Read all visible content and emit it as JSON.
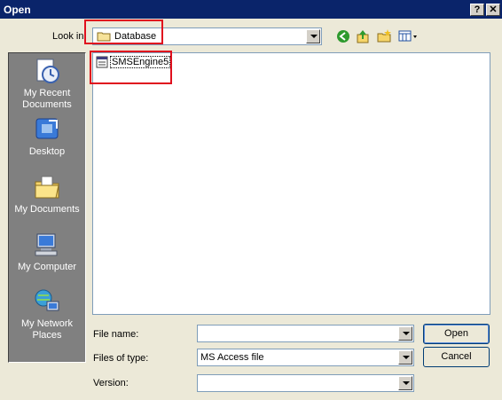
{
  "window": {
    "title": "Open",
    "help_label": "?",
    "close_label": "✕"
  },
  "lookin": {
    "label": "Look in",
    "value": "Database"
  },
  "toolbar": {
    "back_icon": "back-icon",
    "up_icon": "up-folder-icon",
    "new_folder_icon": "new-folder-icon",
    "views_icon": "views-menu-icon"
  },
  "places": [
    {
      "line1": "My Recent",
      "line2": "Documents"
    },
    {
      "line1": "Desktop",
      "line2": ""
    },
    {
      "line1": "My Documents",
      "line2": ""
    },
    {
      "line1": "My Computer",
      "line2": ""
    },
    {
      "line1": "My Network",
      "line2": "Places"
    }
  ],
  "files": [
    {
      "name": "SMSEngine5",
      "icon": "access-db-icon"
    }
  ],
  "fields": {
    "filename_label": "File name:",
    "filename_value": "",
    "filetype_label": "Files of type:",
    "filetype_value": "MS Access file",
    "version_label": "Version:",
    "version_value": ""
  },
  "buttons": {
    "open": "Open",
    "cancel": "Cancel"
  },
  "colors": {
    "highlight": "#e0101e",
    "titlebar": "#0a246a"
  }
}
